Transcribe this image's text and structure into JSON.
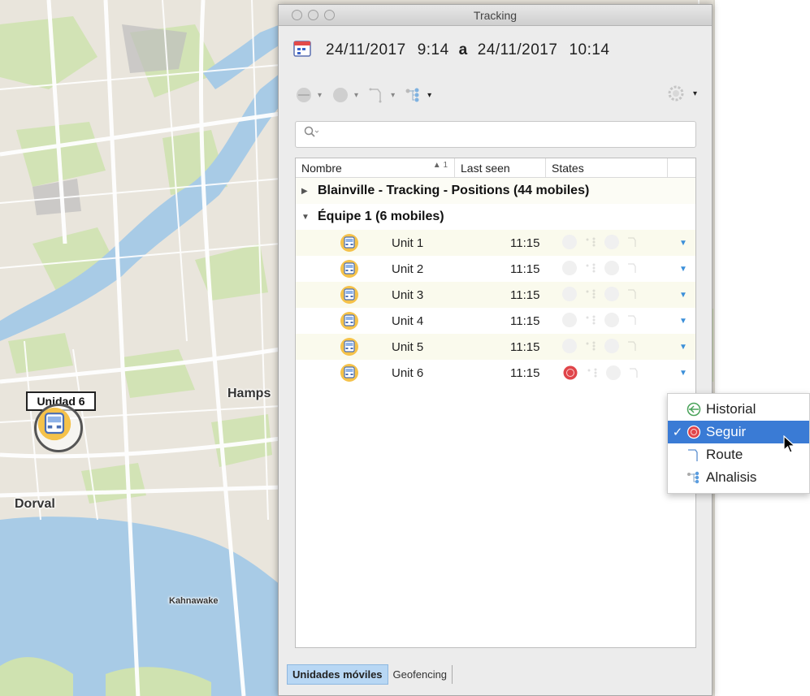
{
  "map": {
    "labels": {
      "hampstead": "Hamps",
      "dorval": "Dorval",
      "kahnawake": "Kahnawake"
    },
    "marker_label": "Unidad 6",
    "colors": {
      "land": "#e9e5dc",
      "water": "#a8cbe6",
      "park": "#cfe2b0",
      "road": "#ffffff"
    }
  },
  "window": {
    "title": "Tracking",
    "range": {
      "from_date": "24/11/2017",
      "from_time": "9:14",
      "separator": "a",
      "to_date": "24/11/2017",
      "to_time": "10:14"
    },
    "toolbar": {
      "icons": [
        "history-icon",
        "follow-icon",
        "route-icon",
        "analysis-icon"
      ],
      "settings_icon": "gear-icon"
    },
    "search": {
      "placeholder": "",
      "icon": "search-icon"
    },
    "table": {
      "columns": {
        "name": "Nombre",
        "sort_indicator": "1",
        "last_seen": "Last seen",
        "states": "States"
      },
      "groups": [
        {
          "label": "Blainville - Tracking - Positions (44 mobiles)",
          "expanded": false
        },
        {
          "label": "Équipe 1 (6 mobiles)",
          "expanded": true
        }
      ],
      "units": [
        {
          "name": "Unit 1",
          "time": "11:15",
          "following": false
        },
        {
          "name": "Unit 2",
          "time": "11:15",
          "following": false
        },
        {
          "name": "Unit 3",
          "time": "11:15",
          "following": false
        },
        {
          "name": "Unit 4",
          "time": "11:15",
          "following": false
        },
        {
          "name": "Unit 5",
          "time": "11:15",
          "following": false
        },
        {
          "name": "Unit 6",
          "time": "11:15",
          "following": true
        }
      ]
    },
    "tabs": {
      "mobile_units": "Unidades móviles",
      "geofencing": "Geofencing"
    }
  },
  "context_menu": {
    "items": [
      {
        "label": "Historial",
        "checked": false,
        "selected": false
      },
      {
        "label": "Seguir",
        "checked": true,
        "selected": true
      },
      {
        "label": "Route",
        "checked": false,
        "selected": false
      },
      {
        "label": "Alnalisis",
        "checked": false,
        "selected": false
      }
    ],
    "check_mark": "✓"
  },
  "colors": {
    "selection": "#3a7bd5",
    "follow_red": "#e0454a",
    "tab_active": "#b8d7f4",
    "caret_blue": "#3b8fd9"
  }
}
